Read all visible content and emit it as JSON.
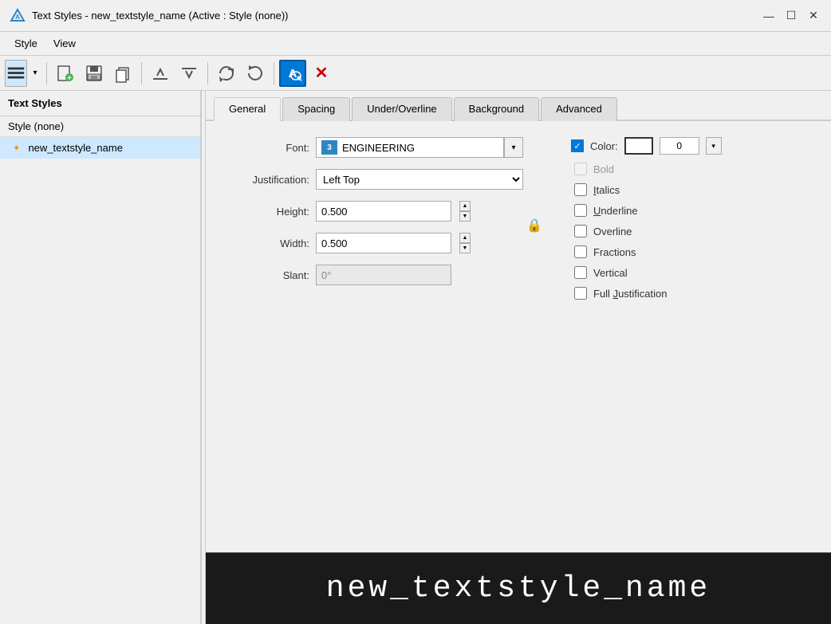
{
  "titlebar": {
    "title": "Text Styles - new_textstyle_name (Active : Style (none))",
    "icon": "A"
  },
  "menubar": {
    "items": [
      "Style",
      "View"
    ]
  },
  "toolbar": {
    "buttons": [
      {
        "name": "list-view",
        "icon": "≡",
        "active": true
      },
      {
        "name": "dropdown-arrow",
        "icon": "▾",
        "active": false
      },
      {
        "name": "new",
        "icon": "📄",
        "active": false
      },
      {
        "name": "save",
        "icon": "💾",
        "active": false
      },
      {
        "name": "copy",
        "icon": "📋",
        "active": false
      },
      {
        "name": "move-up",
        "icon": "↑",
        "active": false
      },
      {
        "name": "move-down",
        "icon": "↓",
        "active": false
      },
      {
        "name": "refresh",
        "icon": "↺",
        "active": false
      },
      {
        "name": "text-style",
        "icon": "A",
        "active": true,
        "special": true
      },
      {
        "name": "delete",
        "icon": "✕",
        "active": false,
        "red": true
      }
    ]
  },
  "sidebar": {
    "header": "Text Styles",
    "style_none": "Style (none)",
    "list_item": "new_textstyle_name"
  },
  "tabs": {
    "items": [
      "General",
      "Spacing",
      "Under/Overline",
      "Background",
      "Advanced"
    ],
    "active": "General"
  },
  "general": {
    "font_label": "Font:",
    "font_icon_text": "3",
    "font_name": "ENGINEERING",
    "justification_label": "Justification:",
    "justification_value": "Left Top",
    "height_label": "Height:",
    "height_value": "0.500",
    "width_label": "Width:",
    "width_value": "0.500",
    "slant_label": "Slant:",
    "slant_value": "0°",
    "color_label": "Color:",
    "color_number": "0",
    "bold_label": "Bold",
    "italics_label": "Italics",
    "underline_label": "Underline",
    "overline_label": "Overline",
    "fractions_label": "Fractions",
    "vertical_label": "Vertical",
    "full_justification_label": "Full Justification"
  },
  "preview": {
    "text": "new_textstyle_name"
  }
}
